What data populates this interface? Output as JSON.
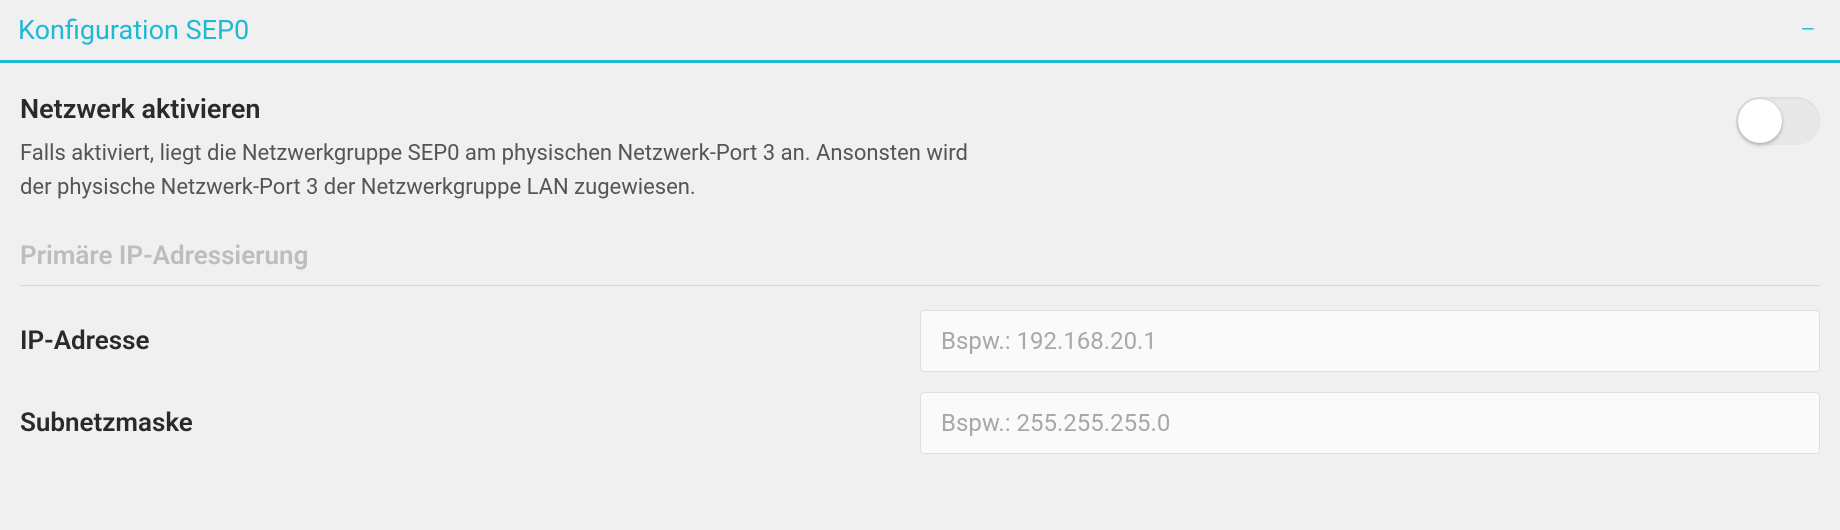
{
  "panel": {
    "title": "Konfiguration SEP0"
  },
  "network_enable": {
    "label": "Netzwerk aktivieren",
    "description": "Falls aktiviert, liegt die Netzwerkgruppe SEP0 am physischen Netzwerk-Port 3 an. Ansonsten wird der physische Netzwerk-Port 3 der Netzwerkgruppe LAN zugewiesen.",
    "state": false
  },
  "primary_addressing": {
    "title": "Primäre IP-Adressierung",
    "ip_address": {
      "label": "IP-Adresse",
      "placeholder": "Bspw.: 192.168.20.1",
      "value": ""
    },
    "subnet_mask": {
      "label": "Subnetzmaske",
      "placeholder": "Bspw.: 255.255.255.0",
      "value": ""
    }
  }
}
